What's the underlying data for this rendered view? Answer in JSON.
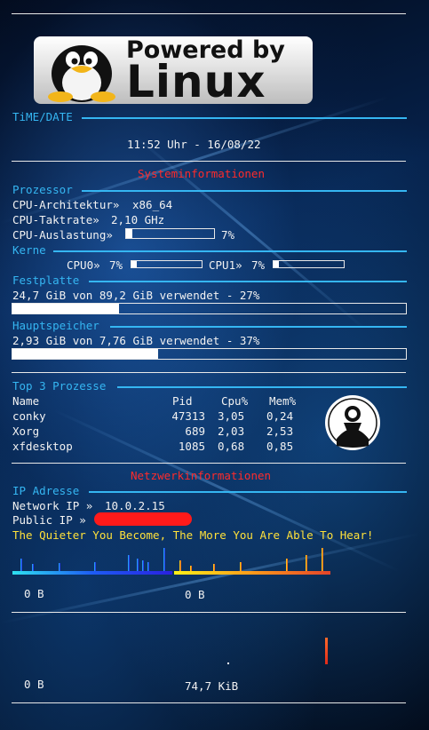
{
  "logo": {
    "line1": "Powered by",
    "line2": "Linux"
  },
  "time": {
    "label": "TiME/DATE",
    "value": "11:52 Uhr - 16/08/22"
  },
  "system": {
    "title": "Systeminformationen"
  },
  "cpu": {
    "label": "Prozessor",
    "arch_label": "CPU-Architektur»",
    "arch": "x86_64",
    "freq_label": "CPU-Taktrate»",
    "freq": "2,10 GHz",
    "load_label": "CPU-Auslastung»",
    "load": "7%",
    "load_fraction": 0.07
  },
  "cores": {
    "label": "Kerne",
    "items": [
      {
        "name": "CPU0»",
        "value": "7%",
        "fraction": 0.07
      },
      {
        "name": "CPU1»",
        "value": "7%",
        "fraction": 0.07
      }
    ]
  },
  "disk": {
    "label": "Festplatte",
    "text": "24,7 GiB von 89,2 GiB verwendet - 27%",
    "fraction": 0.27
  },
  "memory": {
    "label": "Hauptspeicher",
    "text": "2,93 GiB von 7,76 GiB verwendet - 37%",
    "fraction": 0.37
  },
  "processes": {
    "label": "Top 3 Prozesse",
    "headers": [
      "Name",
      "Pid",
      "Cpu%",
      "Mem%"
    ],
    "rows": [
      {
        "name": "conky",
        "pid": "47313",
        "cpu": "3,05",
        "mem": "0,24"
      },
      {
        "name": "Xorg",
        "pid": "689",
        "cpu": "2,03",
        "mem": "2,53"
      },
      {
        "name": "xfdesktop",
        "pid": "1085",
        "cpu": "0,68",
        "mem": "0,85"
      }
    ]
  },
  "network": {
    "title": "Netzwerkinformationen",
    "ip_label": "IP Adresse",
    "network_ip_label": "Network IP »",
    "network_ip": "10.0.2.15",
    "public_ip_label": "Public IP »",
    "quote": "The Quieter You Become, The More You Are Able To Hear!",
    "down_now": "0 B",
    "up_now": "0 B",
    "down_total": "0 B",
    "up_total": "74,7 KiB"
  },
  "colors": {
    "accent": "#35b6f2",
    "title_red": "#ff2b2b",
    "quote_yellow": "#ffe13a"
  },
  "icons": {
    "anonymous": "anonymous-mask-icon",
    "penguin": "tux-penguin-icon"
  }
}
